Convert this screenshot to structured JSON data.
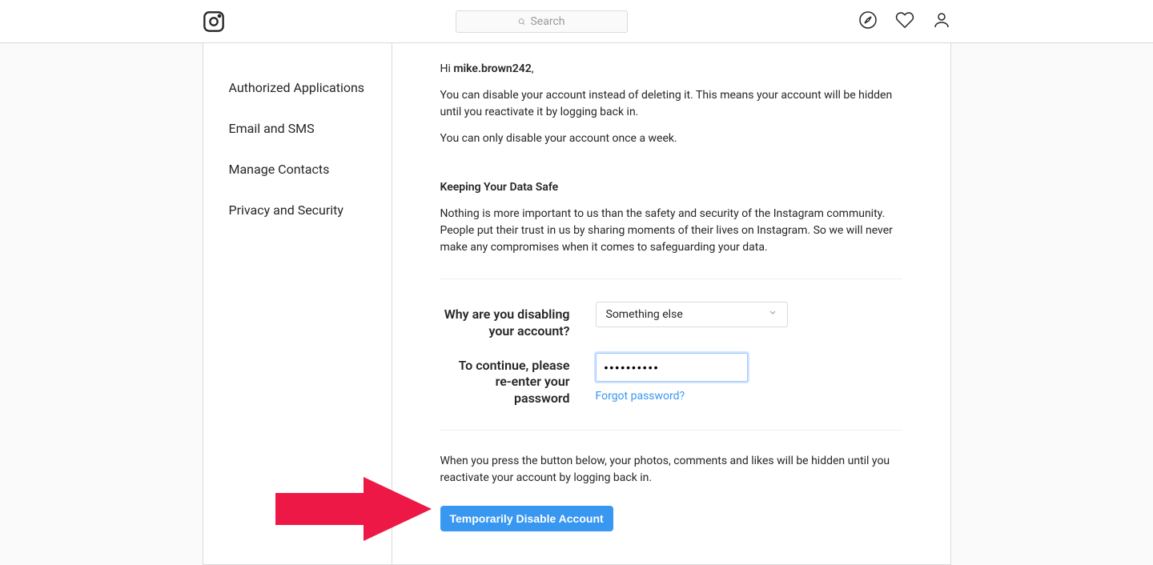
{
  "header": {
    "search_placeholder": "Search"
  },
  "sidebar": {
    "items": [
      {
        "label": "Authorized Applications"
      },
      {
        "label": "Email and SMS"
      },
      {
        "label": "Manage Contacts"
      },
      {
        "label": "Privacy and Security"
      }
    ]
  },
  "content": {
    "greeting_prefix": "Hi ",
    "username": "mike.brown242",
    "greeting_suffix": ",",
    "para1": "You can disable your account instead of deleting it. This means your account will be hidden until you reactivate it by logging back in.",
    "para2": "You can only disable your account once a week.",
    "data_safe_title": "Keeping Your Data Safe",
    "data_safe_para": "Nothing is more important to us than the safety and security of the Instagram community. People put their trust in us by sharing moments of their lives on Instagram. So we will never make any compromises when it comes to safeguarding your data.",
    "reason_label": "Why are you disabling your account?",
    "reason_selected": "Something else",
    "password_label": "To continue, please re-enter your password",
    "password_value": "••••••••••",
    "forgot_password": "Forgot password?",
    "final_para": "When you press the button below, your photos, comments and likes will be hidden until you reactivate your account by logging back in.",
    "disable_button": "Temporarily Disable Account"
  }
}
